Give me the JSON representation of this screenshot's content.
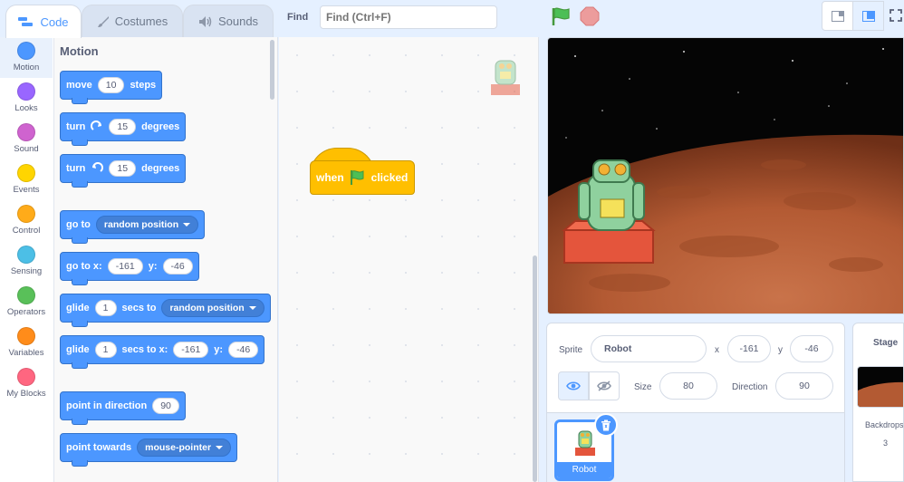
{
  "tabs": [
    {
      "label": "Code",
      "icon": "code-icon"
    },
    {
      "label": "Costumes",
      "icon": "paintbrush-icon"
    },
    {
      "label": "Sounds",
      "icon": "speaker-icon"
    }
  ],
  "find": {
    "label": "Find",
    "placeholder": "Find (Ctrl+F)"
  },
  "controls": {
    "green_flag_color": "#4cbf56",
    "stop_color": "#ec9c9c"
  },
  "categories": [
    {
      "label": "Motion",
      "color": "#4c97ff"
    },
    {
      "label": "Looks",
      "color": "#9966ff"
    },
    {
      "label": "Sound",
      "color": "#cf63cf"
    },
    {
      "label": "Events",
      "color": "#ffd500"
    },
    {
      "label": "Control",
      "color": "#ffab19"
    },
    {
      "label": "Sensing",
      "color": "#4cbfe6"
    },
    {
      "label": "Operators",
      "color": "#59c059"
    },
    {
      "label": "Variables",
      "color": "#ff8c1a"
    },
    {
      "label": "My Blocks",
      "color": "#ff6680"
    }
  ],
  "palette": {
    "heading": "Motion",
    "move": {
      "a": "move",
      "n": "10",
      "b": "steps"
    },
    "turn_right": {
      "a": "turn",
      "n": "15",
      "b": "degrees"
    },
    "turn_left": {
      "a": "turn",
      "n": "15",
      "b": "degrees"
    },
    "goto": {
      "a": "go to",
      "dd": "random position"
    },
    "goto_xy": {
      "a": "go to x:",
      "x": "-161",
      "b": "y:",
      "y": "-46"
    },
    "glide": {
      "a": "glide",
      "n": "1",
      "b": "secs to",
      "dd": "random position"
    },
    "glide_xy": {
      "a": "glide",
      "n": "1",
      "b": "secs to x:",
      "x": "-161",
      "c": "y:",
      "y": "-46"
    },
    "point_dir": {
      "a": "point in direction",
      "n": "90"
    },
    "point_towards": {
      "a": "point towards",
      "dd": "mouse-pointer"
    }
  },
  "workspace": {
    "hat_a": "when",
    "hat_b": "clicked"
  },
  "sprite_info": {
    "sprite_label": "Sprite",
    "sprite_name": "Robot",
    "x_label": "x",
    "x": "-161",
    "y_label": "y",
    "y": "-46",
    "size_label": "Size",
    "size": "80",
    "direction_label": "Direction",
    "direction": "90"
  },
  "sprites": [
    {
      "name": "Robot"
    }
  ],
  "stage_pane": {
    "title": "Stage",
    "backdrops_label": "Backdrops",
    "backdrops_count": "3"
  }
}
